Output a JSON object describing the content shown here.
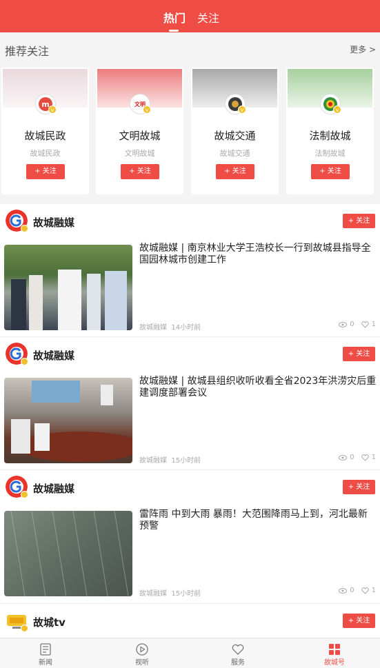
{
  "header": {
    "tabs": [
      {
        "label": "热门"
      },
      {
        "label": "关注"
      }
    ]
  },
  "recommend": {
    "title": "推荐关注",
    "more": "更多 >",
    "cards": [
      {
        "name": "故城民政",
        "sub": "故城民政",
        "follow": "+ 关注",
        "avatar_text": "m"
      },
      {
        "name": "文明故城",
        "sub": "文明故城",
        "follow": "+ 关注",
        "avatar_text": "文明"
      },
      {
        "name": "故城交通",
        "sub": "故城交通",
        "follow": "+ 关注",
        "avatar_text": ""
      },
      {
        "name": "法制故城",
        "sub": "法制故城",
        "follow": "+ 关注",
        "avatar_text": ""
      }
    ]
  },
  "feed": [
    {
      "account": "故城融媒",
      "follow": "+ 关注",
      "headline": "故城融媒 | 南京林业大学王浩校长一行到故城县指导全国园林城市创建工作",
      "source": "故城融媒",
      "time": "14小时前",
      "views": "0",
      "likes": "1"
    },
    {
      "account": "故城融媒",
      "follow": "+ 关注",
      "headline": "故城融媒 | 故城县组织收听收看全省2023年洪涝灾后重建调度部署会议",
      "source": "故城融媒",
      "time": "15小时前",
      "views": "0",
      "likes": "1"
    },
    {
      "account": "故城融媒",
      "follow": "+ 关注",
      "headline": "雷阵雨 中到大雨 暴雨！大范围降雨马上到，河北最新预警",
      "source": "故城融媒",
      "time": "15小时前",
      "views": "0",
      "likes": "1"
    },
    {
      "account": "故城tv",
      "follow": "+ 关注"
    }
  ],
  "bottom_nav": [
    {
      "label": "新闻",
      "icon": "news-icon"
    },
    {
      "label": "视听",
      "icon": "play-icon"
    },
    {
      "label": "服务",
      "icon": "heart-icon"
    },
    {
      "label": "故城号",
      "icon": "grid-icon"
    }
  ],
  "colors": {
    "accent": "#f04c46",
    "badge": "#f2c029"
  }
}
